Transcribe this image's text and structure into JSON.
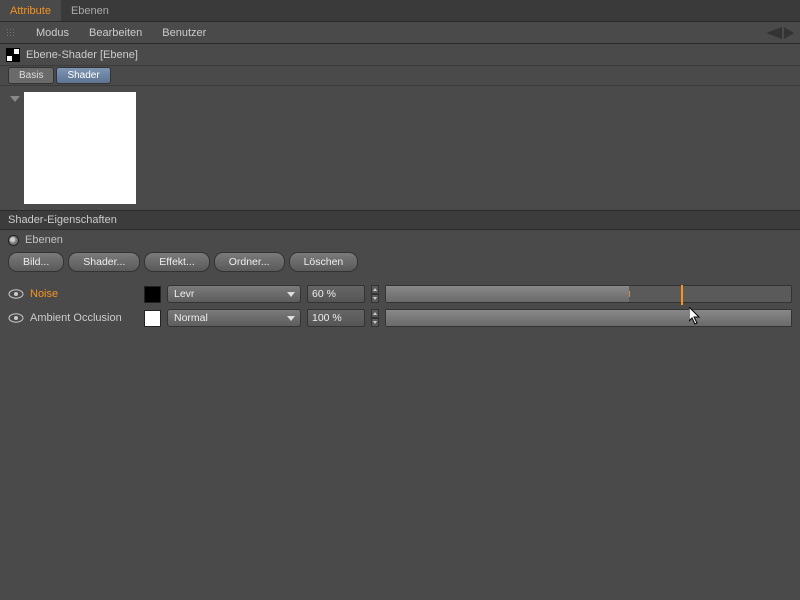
{
  "topTabs": {
    "attribute": "Attribute",
    "ebenen": "Ebenen"
  },
  "menu": {
    "modus": "Modus",
    "bearbeiten": "Bearbeiten",
    "benutzer": "Benutzer"
  },
  "object": {
    "name": "Ebene-Shader [Ebene]"
  },
  "subTabs": {
    "basis": "Basis",
    "shader": "Shader"
  },
  "section": {
    "shaderProps": "Shader-Eigenschaften"
  },
  "radio": {
    "ebenen": "Ebenen"
  },
  "buttons": {
    "bild": "Bild...",
    "shader": "Shader...",
    "effekt": "Effekt...",
    "ordner": "Ordner...",
    "loeschen": "Löschen"
  },
  "layers": [
    {
      "name": "Noise",
      "selected": true,
      "blend": "Levr",
      "value": "60 %",
      "pct": 60,
      "swatch": "noise"
    },
    {
      "name": "Ambient Occlusion",
      "selected": false,
      "blend": "Normal",
      "value": "100 %",
      "pct": 100,
      "swatch": "white"
    }
  ]
}
